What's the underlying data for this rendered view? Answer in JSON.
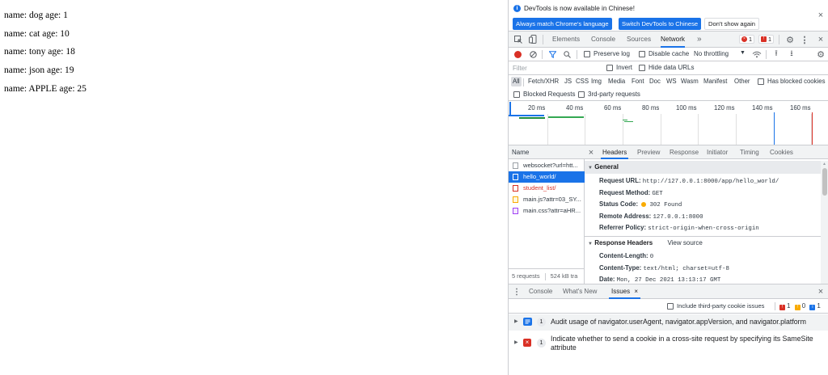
{
  "page": {
    "rows": [
      "name: dog age: 1",
      "name: cat age: 10",
      "name: tony age: 18",
      "name: json age: 19",
      "name: APPLE age: 25"
    ]
  },
  "devtools": {
    "infobar": {
      "message": "DevTools is now available in Chinese!",
      "btn_match": "Always match Chrome's language",
      "btn_switch": "Switch DevTools to Chinese",
      "btn_dismiss": "Don't show again"
    },
    "tabs": [
      "Elements",
      "Console",
      "Sources",
      "Network"
    ],
    "more_tabs": "»",
    "errors_count": "1",
    "issues_count": "1",
    "network_toolbar": {
      "preserve_log": "Preserve log",
      "disable_cache": "Disable cache",
      "throttling": "No throttling"
    },
    "filter": {
      "placeholder": "Filter",
      "invert": "Invert",
      "hide_data_urls": "Hide data URLs"
    },
    "types": [
      "All",
      "Fetch/XHR",
      "JS",
      "CSS",
      "Img",
      "Media",
      "Font",
      "Doc",
      "WS",
      "Wasm",
      "Manifest",
      "Other"
    ],
    "has_blocked_cookies": "Has blocked cookies",
    "blocked_requests": "Blocked Requests",
    "third_party_requests": "3rd-party requests",
    "timeline_ticks": [
      "20 ms",
      "40 ms",
      "60 ms",
      "80 ms",
      "100 ms",
      "120 ms",
      "140 ms",
      "160 ms"
    ],
    "request_list": {
      "header": "Name",
      "items": [
        {
          "name": "websocket?url=htt..."
        },
        {
          "name": "hello_world/"
        },
        {
          "name": "student_list/"
        },
        {
          "name": "main.js?attr=03_SY..."
        },
        {
          "name": "main.css?attr=aHR..."
        }
      ],
      "footer_requests": "5 requests",
      "footer_size": "524 kB tra"
    },
    "detail_tabs": [
      "Headers",
      "Preview",
      "Response",
      "Initiator",
      "Timing",
      "Cookies"
    ],
    "general": {
      "title": "General",
      "request_url_label": "Request URL:",
      "request_url": "http://127.0.0.1:8000/app/hello_world/",
      "request_method_label": "Request Method:",
      "request_method": "GET",
      "status_code_label": "Status Code:",
      "status_code": "302 Found",
      "remote_address_label": "Remote Address:",
      "remote_address": "127.0.0.1:8000",
      "referrer_policy_label": "Referrer Policy:",
      "referrer_policy": "strict-origin-when-cross-origin"
    },
    "response_headers": {
      "title": "Response Headers",
      "view_source": "View source",
      "content_length_label": "Content-Length:",
      "content_length": "0",
      "content_type_label": "Content-Type:",
      "content_type": "text/html; charset=utf-8",
      "date_label": "Date:",
      "date": "Mon, 27 Dec 2021 13:13:17 GMT"
    },
    "drawer": {
      "tabs": [
        "Console",
        "What's New",
        "Issues"
      ],
      "include_third_party": "Include third-party cookie issues",
      "count_red": "1",
      "count_orange": "0",
      "count_blue": "1",
      "issues": [
        {
          "count": "1",
          "text": "Audit usage of navigator.userAgent, navigator.appVersion, and navigator.platform"
        },
        {
          "count": "1",
          "text": "Indicate whether to send a cookie in a cross-site request by specifying its SameSite attribute"
        }
      ]
    }
  }
}
